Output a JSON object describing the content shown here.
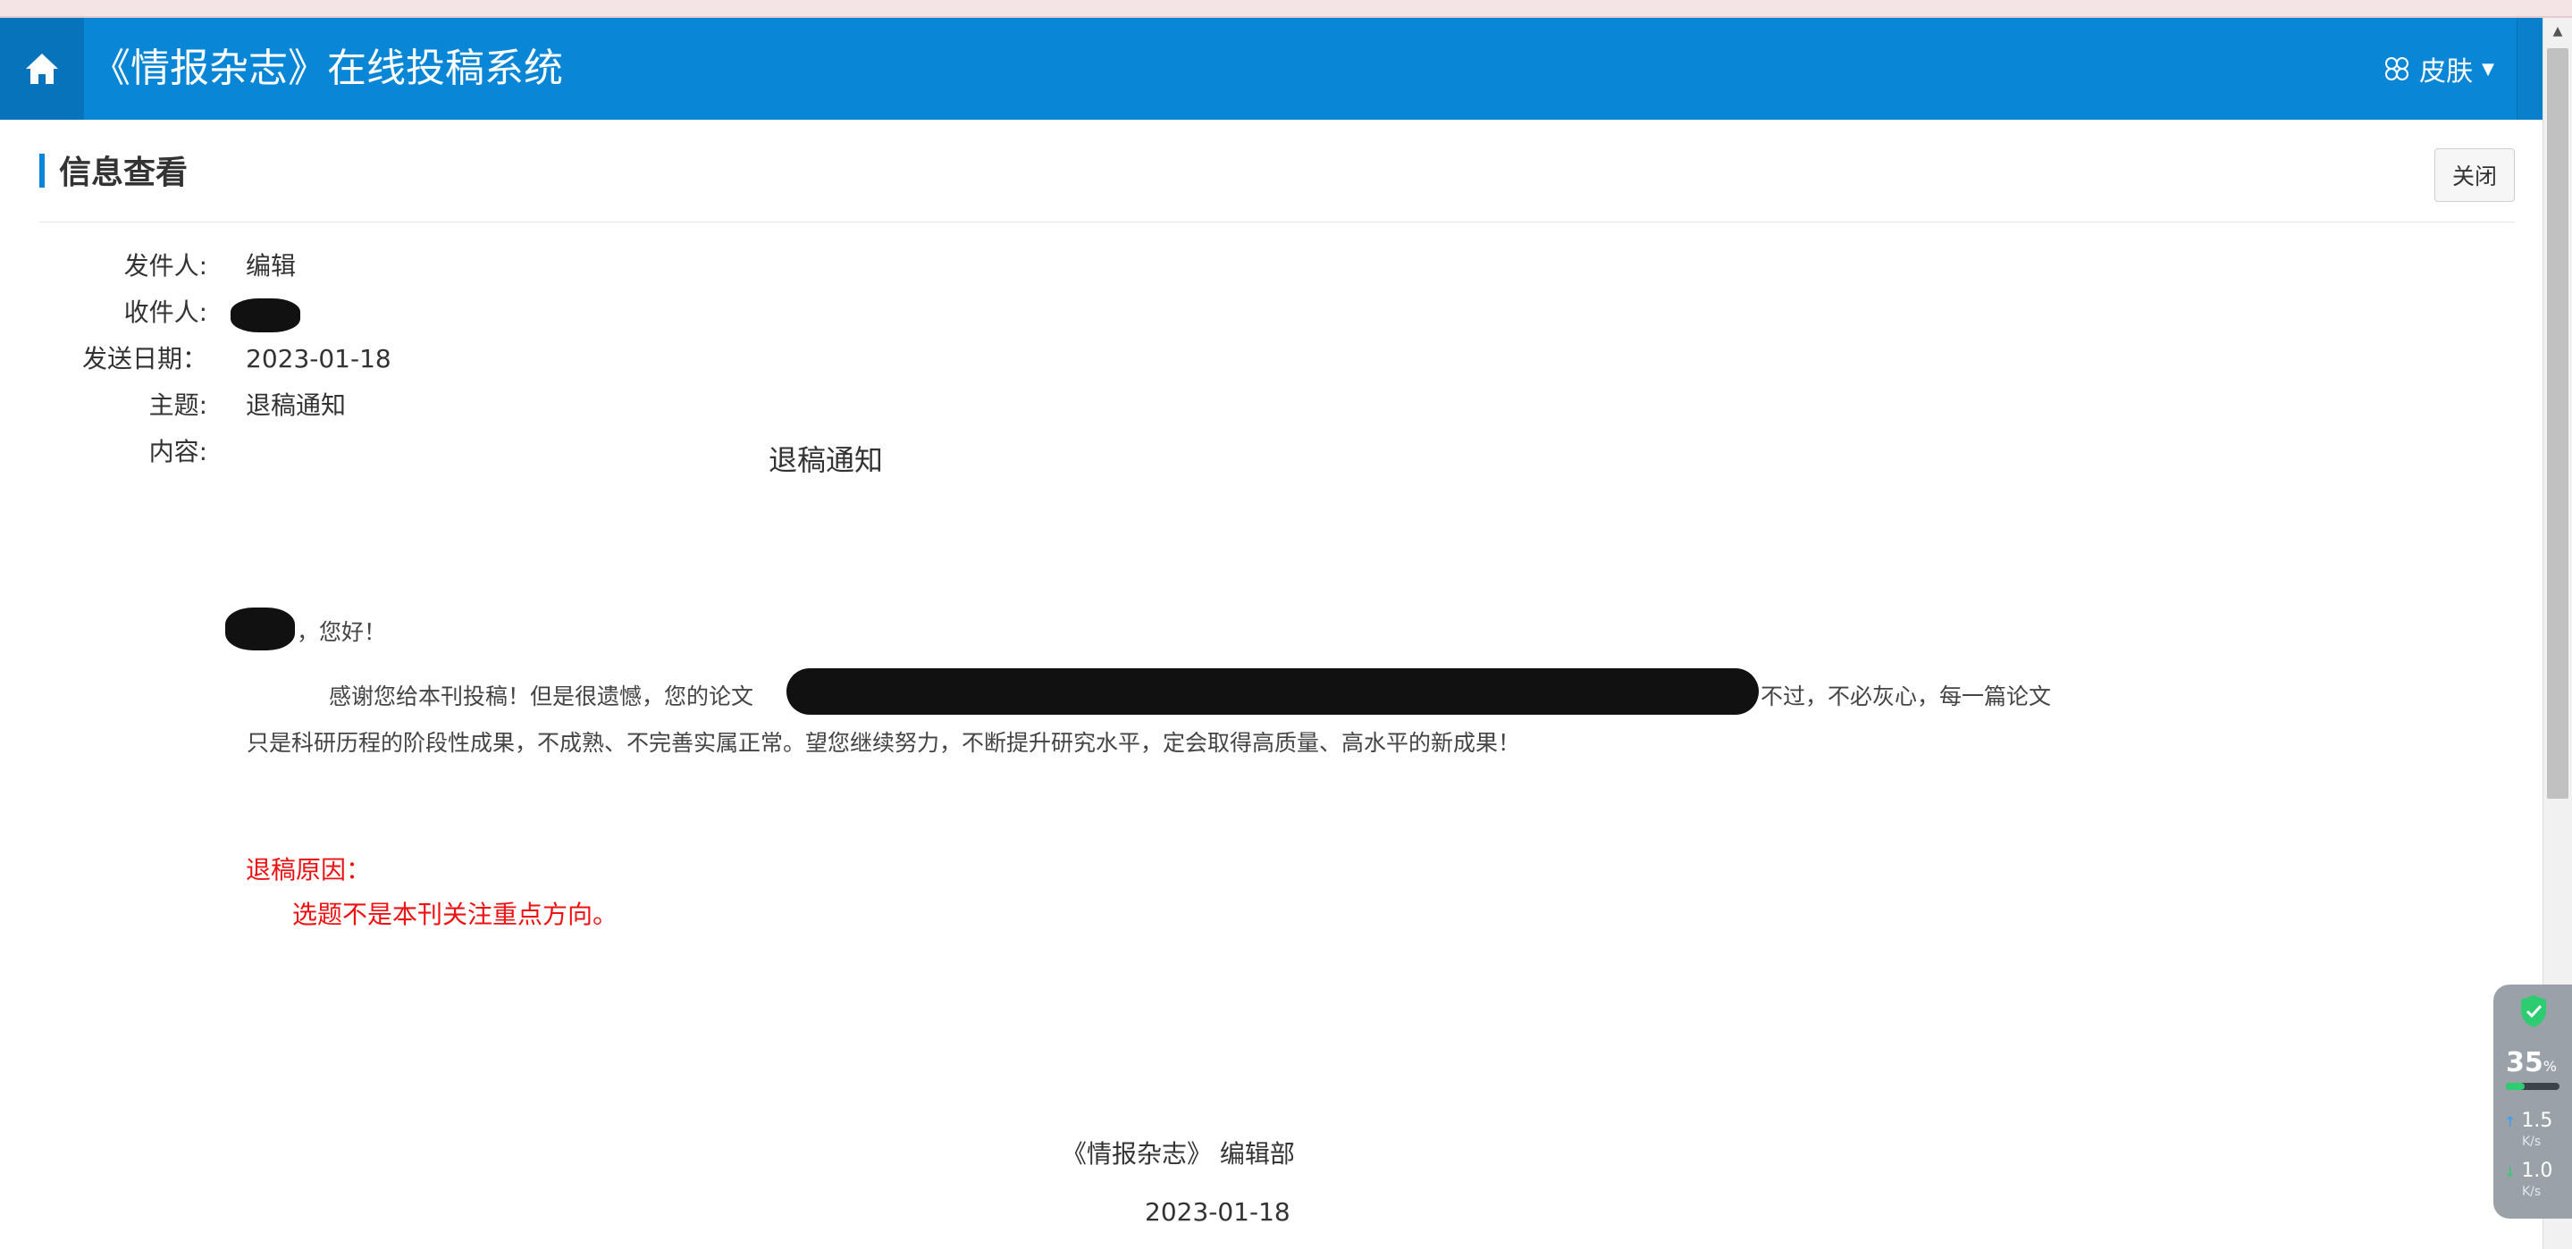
{
  "header": {
    "title": "《情报杂志》在线投稿系统",
    "skin_label": "皮肤"
  },
  "page": {
    "title": "信息查看",
    "close_label": "关闭"
  },
  "info": {
    "sender_label": "发件人:",
    "sender_value": "编辑",
    "recipient_label": "收件人:",
    "date_label": "发送日期：",
    "date_value": "2023-01-18",
    "subject_label": "主题:",
    "subject_value": "退稿通知",
    "content_label": "内容:"
  },
  "letter": {
    "title": "退稿通知",
    "greeting": "，您好！",
    "para1_start": "感谢您给本刊投稿！但是很遗憾，您的论文",
    "para1_end": "不过，不必灰心，每一篇论文",
    "para2": "只是科研历程的阶段性成果，不成熟、不完善实属正常。望您继续努力，不断提升研究水平，定会取得高质量、高水平的新成果！",
    "reason_label": "退稿原因：",
    "reason_text": "选题不是本刊关注重点方向。",
    "signature": "《情报杂志》 编辑部",
    "signature_date": "2023-01-18"
  },
  "widget": {
    "percent": "35",
    "percent_unit": "%",
    "cpu_fraction": 0.35,
    "up_speed": "1.5",
    "up_unit": "K/s",
    "down_speed": "1.0",
    "down_unit": "K/s"
  }
}
